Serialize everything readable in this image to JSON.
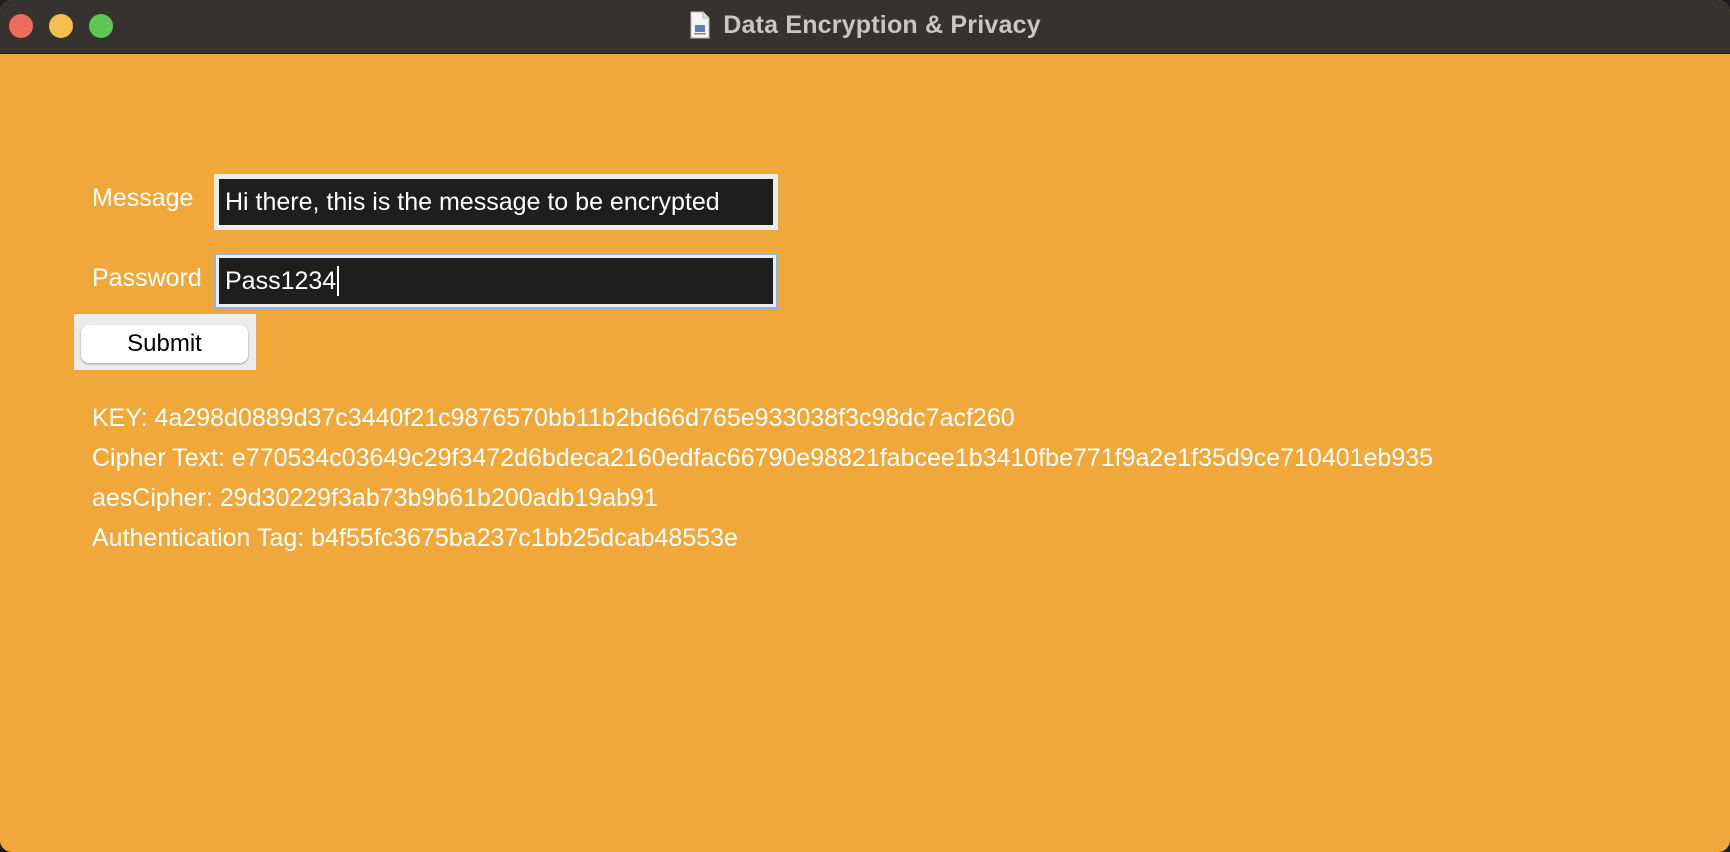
{
  "window": {
    "title": "Data Encryption & Privacy",
    "icon": "document-icon",
    "colors": {
      "titlebar": "#363230",
      "background": "#f0a83a",
      "close": "#ed6a5e",
      "minimize": "#f4bf4f",
      "maximize": "#61c554"
    }
  },
  "form": {
    "message_label": "Message",
    "message_value": "Hi there, this is the message to be encrypted",
    "password_label": "Password",
    "password_value": "Pass1234",
    "submit_label": "Submit"
  },
  "results": {
    "key": "KEY: 4a298d0889d37c3440f21c9876570bb11b2bd66d765e933038f3c98dc7acf260",
    "cipher_text": "Cipher Text: e770534c03649c29f3472d6bdeca2160edfac66790e98821fabcee1b3410fbe771f9a2e1f35d9ce710401eb935",
    "aes_cipher": "aesCipher: 29d30229f3ab73b9b61b200adb19ab91",
    "auth_tag": "Authentication Tag: b4f55fc3675ba237c1bb25dcab48553e"
  }
}
